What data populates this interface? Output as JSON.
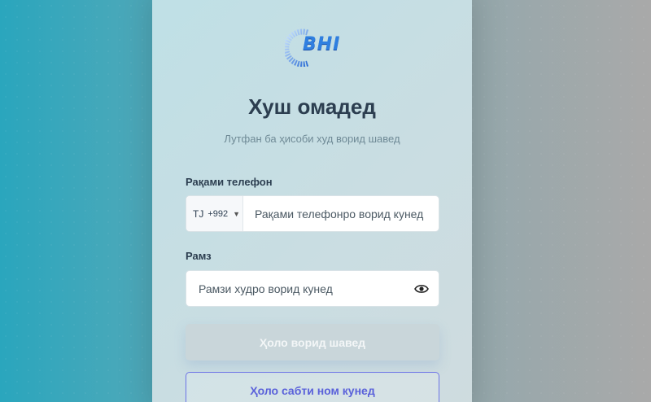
{
  "brand": {
    "logo_text": "BHI"
  },
  "login": {
    "title": "Хуш омадед",
    "subtitle": "Лутфан ба ҳисоби худ ворид шавед",
    "phone": {
      "label": "Рақами телефон",
      "country_iso": "TJ",
      "country_code": "+992",
      "placeholder": "Рақами телефонро ворид кунед"
    },
    "password": {
      "label": "Рамз",
      "placeholder": "Рамзи худро ворид кунед"
    },
    "login_button": "Ҳоло ворид шавед",
    "register_button": "Ҳоло сабти ном кунед"
  },
  "icons": {
    "logo": "bhi-logo-icon",
    "country_dropdown": "chevron-down-icon",
    "password_toggle": "eye-icon"
  },
  "colors": {
    "primary": "#5a61da",
    "disabled_button": "#c9d6da",
    "heading": "#2c3e50"
  }
}
